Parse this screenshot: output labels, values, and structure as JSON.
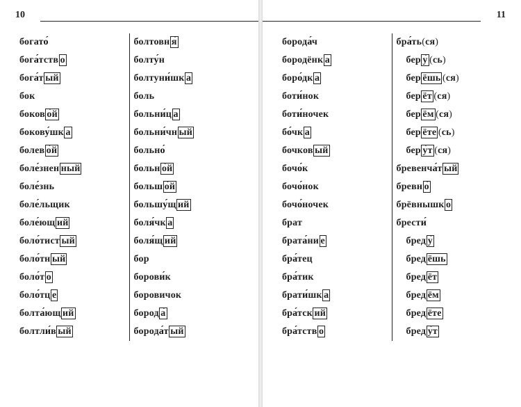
{
  "pages": {
    "left": {
      "num": "10"
    },
    "right": {
      "num": "11"
    }
  },
  "columns": [
    [
      {
        "parts": [
          [
            "t",
            "богат"
          ],
          [
            "s",
            "о́"
          ]
        ]
      },
      {
        "parts": [
          [
            "t",
            "бог"
          ],
          [
            "s",
            "а́"
          ],
          [
            "t",
            "тств"
          ],
          [
            "b",
            "о"
          ]
        ]
      },
      {
        "parts": [
          [
            "t",
            "бог"
          ],
          [
            "s",
            "а́"
          ],
          [
            "t",
            "т"
          ],
          [
            "b",
            "ый"
          ]
        ]
      },
      {
        "parts": [
          [
            "t",
            "бок"
          ]
        ]
      },
      {
        "parts": [
          [
            "t",
            "боков"
          ],
          [
            "b",
            "о́й"
          ]
        ]
      },
      {
        "parts": [
          [
            "t",
            "боков"
          ],
          [
            "s",
            "у́"
          ],
          [
            "t",
            "шк"
          ],
          [
            "b",
            "а"
          ]
        ]
      },
      {
        "parts": [
          [
            "t",
            "болев"
          ],
          [
            "b",
            "о́й"
          ]
        ]
      },
      {
        "parts": [
          [
            "t",
            "бол"
          ],
          [
            "s",
            "е́"
          ],
          [
            "t",
            "знен"
          ],
          [
            "b",
            "ный"
          ]
        ]
      },
      {
        "parts": [
          [
            "t",
            "бол"
          ],
          [
            "s",
            "е́"
          ],
          [
            "t",
            "знь"
          ]
        ]
      },
      {
        "parts": [
          [
            "t",
            "бол"
          ],
          [
            "s",
            "е́"
          ],
          [
            "t",
            "льщик"
          ]
        ]
      },
      {
        "parts": [
          [
            "t",
            "бол"
          ],
          [
            "s",
            "е́"
          ],
          [
            "t",
            "ющ"
          ],
          [
            "b",
            "ий"
          ]
        ]
      },
      {
        "parts": [
          [
            "t",
            "бол"
          ],
          [
            "s",
            "о́"
          ],
          [
            "t",
            "тист"
          ],
          [
            "b",
            "ый"
          ]
        ]
      },
      {
        "parts": [
          [
            "t",
            "бол"
          ],
          [
            "s",
            "о́"
          ],
          [
            "t",
            "тн"
          ],
          [
            "b",
            "ый"
          ]
        ]
      },
      {
        "parts": [
          [
            "t",
            "бол"
          ],
          [
            "s",
            "о́"
          ],
          [
            "t",
            "т"
          ],
          [
            "b",
            "о"
          ]
        ]
      },
      {
        "parts": [
          [
            "t",
            "бол"
          ],
          [
            "s",
            "о́"
          ],
          [
            "t",
            "тц"
          ],
          [
            "b",
            "е"
          ]
        ]
      },
      {
        "parts": [
          [
            "t",
            "болт"
          ],
          [
            "s",
            "а́"
          ],
          [
            "t",
            "ющ"
          ],
          [
            "b",
            "ий"
          ]
        ]
      },
      {
        "parts": [
          [
            "t",
            "болтл"
          ],
          [
            "s",
            "и́"
          ],
          [
            "t",
            "в"
          ],
          [
            "b",
            "ый"
          ]
        ]
      }
    ],
    [
      {
        "parts": [
          [
            "t",
            "болтовн"
          ],
          [
            "b",
            "я́"
          ]
        ]
      },
      {
        "parts": [
          [
            "t",
            "болт"
          ],
          [
            "s",
            "у́"
          ],
          [
            "t",
            "н"
          ]
        ]
      },
      {
        "parts": [
          [
            "t",
            "болтун"
          ],
          [
            "s",
            "и́"
          ],
          [
            "t",
            "шк"
          ],
          [
            "b",
            "а"
          ]
        ]
      },
      {
        "parts": [
          [
            "t",
            "боль"
          ]
        ]
      },
      {
        "parts": [
          [
            "t",
            "больн"
          ],
          [
            "s",
            "и́"
          ],
          [
            "t",
            "ц"
          ],
          [
            "b",
            "а"
          ]
        ]
      },
      {
        "parts": [
          [
            "t",
            "больн"
          ],
          [
            "s",
            "и́"
          ],
          [
            "t",
            "чн"
          ],
          [
            "b",
            "ый"
          ]
        ]
      },
      {
        "parts": [
          [
            "t",
            "больн"
          ],
          [
            "s",
            "о́"
          ]
        ]
      },
      {
        "parts": [
          [
            "t",
            "больн"
          ],
          [
            "b",
            "о́й"
          ]
        ]
      },
      {
        "parts": [
          [
            "t",
            "больш"
          ],
          [
            "b",
            "о́й"
          ]
        ]
      },
      {
        "parts": [
          [
            "t",
            "больш"
          ],
          [
            "s",
            "у́"
          ],
          [
            "t",
            "щ"
          ],
          [
            "b",
            "ий"
          ]
        ]
      },
      {
        "parts": [
          [
            "t",
            "бол"
          ],
          [
            "s",
            "я́"
          ],
          [
            "t",
            "чк"
          ],
          [
            "b",
            "а"
          ]
        ]
      },
      {
        "parts": [
          [
            "t",
            "бол"
          ],
          [
            "s",
            "я́"
          ],
          [
            "t",
            "щ"
          ],
          [
            "b",
            "ий"
          ]
        ]
      },
      {
        "parts": [
          [
            "t",
            "бор"
          ]
        ]
      },
      {
        "parts": [
          [
            "t",
            "боров"
          ],
          [
            "s",
            "и́"
          ],
          [
            "t",
            "к"
          ]
        ]
      },
      {
        "parts": [
          [
            "t",
            "боровичок"
          ]
        ]
      },
      {
        "parts": [
          [
            "t",
            "бород"
          ],
          [
            "b",
            "а́"
          ]
        ]
      },
      {
        "parts": [
          [
            "t",
            "бород"
          ],
          [
            "s",
            "а́"
          ],
          [
            "t",
            "т"
          ],
          [
            "b",
            "ый"
          ]
        ]
      }
    ],
    [
      {
        "parts": [
          [
            "t",
            "бород"
          ],
          [
            "s",
            "а́"
          ],
          [
            "t",
            "ч"
          ]
        ]
      },
      {
        "parts": [
          [
            "t",
            "бородёнк"
          ],
          [
            "b",
            "а"
          ]
        ]
      },
      {
        "parts": [
          [
            "t",
            "бор"
          ],
          [
            "s",
            "о́"
          ],
          [
            "t",
            "дк"
          ],
          [
            "b",
            "а"
          ]
        ]
      },
      {
        "parts": [
          [
            "t",
            "бот"
          ],
          [
            "s",
            "и́"
          ],
          [
            "t",
            "нок"
          ]
        ]
      },
      {
        "parts": [
          [
            "t",
            "бот"
          ],
          [
            "s",
            "и́"
          ],
          [
            "t",
            "ночек"
          ]
        ]
      },
      {
        "parts": [
          [
            "t",
            "б"
          ],
          [
            "s",
            "о́"
          ],
          [
            "t",
            "чк"
          ],
          [
            "b",
            "а"
          ]
        ]
      },
      {
        "parts": [
          [
            "t",
            "бочков"
          ],
          [
            "b",
            "ый"
          ]
        ]
      },
      {
        "parts": [
          [
            "t",
            "боч"
          ],
          [
            "s",
            "о́"
          ],
          [
            "t",
            "к"
          ]
        ]
      },
      {
        "parts": [
          [
            "t",
            "боч"
          ],
          [
            "s",
            "о́"
          ],
          [
            "t",
            "нок"
          ]
        ]
      },
      {
        "parts": [
          [
            "t",
            "боч"
          ],
          [
            "s",
            "о́"
          ],
          [
            "t",
            "ночек"
          ]
        ]
      },
      {
        "parts": [
          [
            "t",
            "брат"
          ]
        ]
      },
      {
        "parts": [
          [
            "t",
            "брат"
          ],
          [
            "s",
            "а́"
          ],
          [
            "t",
            "ни"
          ],
          [
            "b",
            "е"
          ]
        ]
      },
      {
        "parts": [
          [
            "t",
            "бр"
          ],
          [
            "s",
            "а́"
          ],
          [
            "t",
            "тец"
          ]
        ]
      },
      {
        "parts": [
          [
            "t",
            "бр"
          ],
          [
            "s",
            "а́"
          ],
          [
            "t",
            "тик"
          ]
        ]
      },
      {
        "parts": [
          [
            "t",
            "брат"
          ],
          [
            "s",
            "и́"
          ],
          [
            "t",
            "шк"
          ],
          [
            "b",
            "а"
          ]
        ]
      },
      {
        "parts": [
          [
            "t",
            "бр"
          ],
          [
            "s",
            "а́"
          ],
          [
            "t",
            "тск"
          ],
          [
            "b",
            "ий"
          ]
        ]
      },
      {
        "parts": [
          [
            "t",
            "бр"
          ],
          [
            "s",
            "а́"
          ],
          [
            "t",
            "тств"
          ],
          [
            "b",
            "о"
          ]
        ]
      }
    ],
    [
      {
        "parts": [
          [
            "t",
            "бр"
          ],
          [
            "s",
            "а́"
          ],
          [
            "t",
            "ть"
          ],
          [
            "p",
            "("
          ],
          [
            "t",
            "ся"
          ],
          [
            "p",
            ")"
          ]
        ]
      },
      {
        "indent": true,
        "parts": [
          [
            "t",
            "бер"
          ],
          [
            "b",
            "у́"
          ],
          [
            "p",
            "("
          ],
          [
            "t",
            "сь"
          ],
          [
            "p",
            ")"
          ]
        ]
      },
      {
        "indent": true,
        "parts": [
          [
            "t",
            "бер"
          ],
          [
            "b",
            "ёшь"
          ],
          [
            "p",
            "("
          ],
          [
            "t",
            "ся"
          ],
          [
            "p",
            ")"
          ]
        ]
      },
      {
        "indent": true,
        "parts": [
          [
            "t",
            "бер"
          ],
          [
            "b",
            "ёт"
          ],
          [
            "p",
            "("
          ],
          [
            "t",
            "ся"
          ],
          [
            "p",
            ")"
          ]
        ]
      },
      {
        "indent": true,
        "parts": [
          [
            "t",
            "бер"
          ],
          [
            "b",
            "ём"
          ],
          [
            "p",
            "("
          ],
          [
            "t",
            "ся"
          ],
          [
            "p",
            ")"
          ]
        ]
      },
      {
        "indent": true,
        "parts": [
          [
            "t",
            "бер"
          ],
          [
            "b",
            "ёте"
          ],
          [
            "p",
            "("
          ],
          [
            "t",
            "сь"
          ],
          [
            "p",
            ")"
          ]
        ]
      },
      {
        "indent": true,
        "parts": [
          [
            "t",
            "бер"
          ],
          [
            "b",
            "у́т"
          ],
          [
            "p",
            "("
          ],
          [
            "t",
            "ся"
          ],
          [
            "p",
            ")"
          ]
        ]
      },
      {
        "parts": [
          [
            "t",
            "бревенч"
          ],
          [
            "s",
            "а́"
          ],
          [
            "t",
            "т"
          ],
          [
            "b",
            "ый"
          ]
        ]
      },
      {
        "parts": [
          [
            "t",
            "бревн"
          ],
          [
            "b",
            "о́"
          ]
        ]
      },
      {
        "parts": [
          [
            "t",
            "брёвнышк"
          ],
          [
            "b",
            "о"
          ]
        ]
      },
      {
        "parts": [
          [
            "t",
            "брест"
          ],
          [
            "s",
            "и́"
          ]
        ]
      },
      {
        "indent": true,
        "parts": [
          [
            "t",
            "бред"
          ],
          [
            "b",
            "у́"
          ]
        ]
      },
      {
        "indent": true,
        "parts": [
          [
            "t",
            "бред"
          ],
          [
            "b",
            "ёшь"
          ]
        ]
      },
      {
        "indent": true,
        "parts": [
          [
            "t",
            "бред"
          ],
          [
            "b",
            "ёт"
          ]
        ]
      },
      {
        "indent": true,
        "parts": [
          [
            "t",
            "бред"
          ],
          [
            "b",
            "ём"
          ]
        ]
      },
      {
        "indent": true,
        "parts": [
          [
            "t",
            "бред"
          ],
          [
            "b",
            "ёте"
          ]
        ]
      },
      {
        "indent": true,
        "parts": [
          [
            "t",
            "бред"
          ],
          [
            "b",
            "у́т"
          ]
        ]
      }
    ]
  ]
}
